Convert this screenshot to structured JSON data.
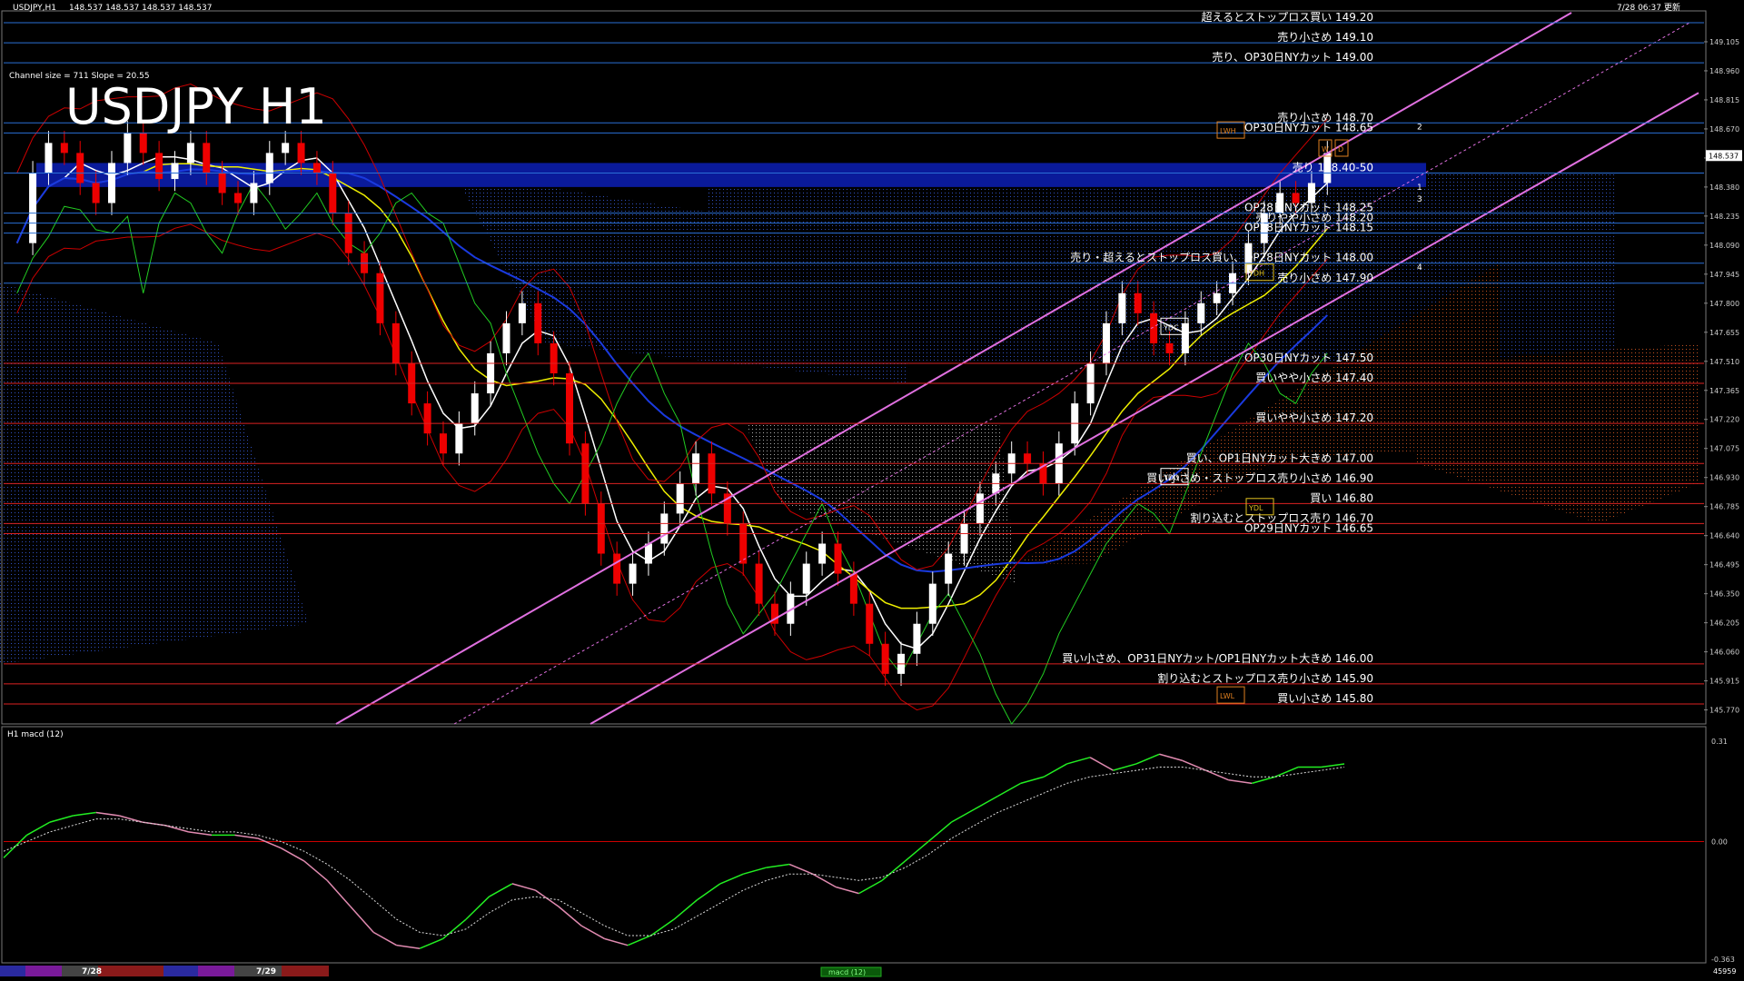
{
  "window": {
    "title": "USDJPY,H1",
    "ohlc": "148.537 148.537 148.537 148.537",
    "updated": "7/28 06:37 更新"
  },
  "symbol_label": "USDJPY H1",
  "channel_info": "Channel size = 711  Slope = 20.55",
  "indicator": {
    "title": "H1  macd (12)",
    "footer_label": "macd (12)",
    "footer_right": "45959"
  },
  "chart_data": [
    {
      "type": "line",
      "title": "USDJPY H1",
      "ylim": [
        145.7,
        149.25
      ],
      "current_price": "148.537",
      "price_ticks": [
        "149.105",
        "148.960",
        "148.815",
        "148.670",
        "148.525",
        "148.380",
        "148.235",
        "148.090",
        "147.945",
        "147.800",
        "147.655",
        "147.510",
        "147.365",
        "147.220",
        "147.075",
        "146.930",
        "146.785",
        "146.640",
        "146.495",
        "146.350",
        "146.205",
        "146.060",
        "145.915",
        "145.770"
      ],
      "close_series": [
        148.1,
        148.45,
        148.6,
        148.55,
        148.4,
        148.3,
        148.5,
        148.65,
        148.55,
        148.42,
        148.5,
        148.6,
        148.45,
        148.35,
        148.3,
        148.4,
        148.55,
        148.6,
        148.5,
        148.45,
        148.25,
        148.05,
        147.95,
        147.7,
        147.5,
        147.3,
        147.15,
        147.05,
        147.2,
        147.35,
        147.55,
        147.7,
        147.8,
        147.6,
        147.45,
        147.1,
        146.8,
        146.55,
        146.4,
        146.5,
        146.6,
        146.75,
        146.9,
        147.05,
        146.85,
        146.7,
        146.5,
        146.3,
        146.2,
        146.35,
        146.5,
        146.6,
        146.45,
        146.3,
        146.1,
        145.95,
        146.05,
        146.2,
        146.4,
        146.55,
        146.7,
        146.85,
        146.95,
        147.05,
        147.0,
        146.9,
        147.1,
        147.3,
        147.5,
        147.7,
        147.85,
        147.75,
        147.6,
        147.55,
        147.7,
        147.8,
        147.85,
        147.95,
        148.1,
        148.25,
        148.35,
        148.3,
        148.4,
        148.55
      ],
      "levels": [
        {
          "price": 149.2,
          "label": "超えるとストップロス買い 149.20",
          "color": "#2a6fd6"
        },
        {
          "price": 149.1,
          "label": "売り小さめ 149.10",
          "color": "#2a6fd6"
        },
        {
          "price": 149.0,
          "label": "売り、OP30日NYカット 149.00",
          "color": "#2a6fd6"
        },
        {
          "price": 148.7,
          "label": "売り小さめ 148.70",
          "color": "#2a6fd6"
        },
        {
          "price": 148.65,
          "label": "OP30日NYカット 148.65",
          "color": "#2a6fd6"
        },
        {
          "price": 148.45,
          "label": "売り 148.40-50",
          "color": "#2a6fd6"
        },
        {
          "price": 148.25,
          "label": "OP28日NYカット 148.25",
          "color": "#2a6fd6"
        },
        {
          "price": 148.2,
          "label": "売りやや小さめ 148.20",
          "color": "#2a6fd6"
        },
        {
          "price": 148.15,
          "label": "OP28日NYカット 148.15",
          "color": "#2a6fd6"
        },
        {
          "price": 148.0,
          "label": "売り・超えるとストップロス買い、OP28日NYカット 148.00",
          "color": "#2a6fd6"
        },
        {
          "price": 147.9,
          "label": "売り小さめ 147.90",
          "color": "#2a6fd6"
        },
        {
          "price": 147.5,
          "label": "OP30日NYカット 147.50",
          "color": "#d22"
        },
        {
          "price": 147.4,
          "label": "買いやや小さめ 147.40",
          "color": "#d22"
        },
        {
          "price": 147.2,
          "label": "買いやや小さめ 147.20",
          "color": "#d22"
        },
        {
          "price": 147.0,
          "label": "買い、OP1日NYカット大きめ 147.00",
          "color": "#d22"
        },
        {
          "price": 146.9,
          "label": "買い小さめ・ストップロス売り小さめ 146.90",
          "color": "#d22"
        },
        {
          "price": 146.8,
          "label": "買い 146.80",
          "color": "#d22"
        },
        {
          "price": 146.7,
          "label": "割り込むとストップロス売り 146.70",
          "color": "#d22"
        },
        {
          "price": 146.65,
          "label": "OP29日NYカット 146.65",
          "color": "#d22"
        },
        {
          "price": 146.0,
          "label": "買い小さめ、OP31日NYカット/OP1日NYカット大きめ 146.00",
          "color": "#d22"
        },
        {
          "price": 145.9,
          "label": "割り込むとストップロス売り小さめ 145.90",
          "color": "#d22"
        },
        {
          "price": 145.8,
          "label": "買い小さめ 145.80",
          "color": "#d22"
        }
      ],
      "markers": [
        "LWH",
        "YDH",
        "YDC",
        "YDO",
        "YDL",
        "LWL",
        "W",
        "D"
      ],
      "channel_numbers": [
        "2",
        "1",
        "3",
        "4"
      ]
    },
    {
      "type": "line",
      "title": "macd (12)",
      "ylim": [
        -0.363,
        0.31
      ],
      "ticks": [
        "0.31",
        "0.00",
        "-0.363"
      ],
      "series": [
        {
          "values": [
            -0.05,
            0.02,
            0.06,
            0.08,
            0.09,
            0.08,
            0.06,
            0.05,
            0.03,
            0.02,
            0.02,
            0.01,
            -0.02,
            -0.06,
            -0.12,
            -0.2,
            -0.28,
            -0.32,
            -0.33,
            -0.3,
            -0.24,
            -0.17,
            -0.13,
            -0.15,
            -0.2,
            -0.26,
            -0.3,
            -0.32,
            -0.29,
            -0.24,
            -0.18,
            -0.13,
            -0.1,
            -0.08,
            -0.07,
            -0.1,
            -0.14,
            -0.16,
            -0.12,
            -0.06,
            0.0,
            0.06,
            0.1,
            0.14,
            0.18,
            0.2,
            0.24,
            0.26,
            0.22,
            0.24,
            0.27,
            0.25,
            0.22,
            0.19,
            0.18,
            0.2,
            0.23,
            0.23,
            0.24
          ]
        },
        {
          "values": [
            -0.03,
            0.0,
            0.03,
            0.05,
            0.07,
            0.07,
            0.06,
            0.05,
            0.04,
            0.03,
            0.03,
            0.02,
            0.0,
            -0.03,
            -0.07,
            -0.12,
            -0.18,
            -0.24,
            -0.28,
            -0.29,
            -0.27,
            -0.22,
            -0.18,
            -0.17,
            -0.18,
            -0.22,
            -0.26,
            -0.29,
            -0.29,
            -0.27,
            -0.23,
            -0.19,
            -0.15,
            -0.12,
            -0.1,
            -0.1,
            -0.11,
            -0.12,
            -0.11,
            -0.08,
            -0.04,
            0.01,
            0.05,
            0.09,
            0.12,
            0.15,
            0.18,
            0.2,
            0.21,
            0.22,
            0.23,
            0.23,
            0.22,
            0.21,
            0.2,
            0.2,
            0.21,
            0.22,
            0.23
          ]
        }
      ]
    }
  ],
  "timeline": {
    "labels": [
      "7/28",
      "7/29"
    ]
  }
}
